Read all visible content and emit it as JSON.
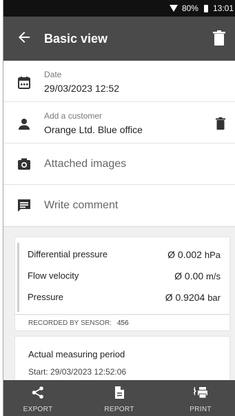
{
  "status_bar": {
    "battery": "80%",
    "time": "13:01"
  },
  "app_bar": {
    "title": "Basic view",
    "back_icon": "arrow-left-icon",
    "delete_icon": "trash-icon"
  },
  "date_row": {
    "label": "Date",
    "value": "29/03/2023 12:52",
    "icon": "calendar-icon"
  },
  "customer_row": {
    "label": "Add a customer",
    "value": "Orange Ltd. Blue office",
    "icon": "person-icon",
    "delete_icon": "trash-icon"
  },
  "images_row": {
    "label": "Attached images",
    "icon": "camera-icon"
  },
  "comment_row": {
    "label": "Write comment",
    "icon": "comment-icon"
  },
  "measurements": [
    {
      "name": "Differential pressure",
      "value": "Ø 0.002",
      "unit": "hPa"
    },
    {
      "name": "Flow velocity",
      "value": "Ø 0.00",
      "unit": "m/s"
    },
    {
      "name": "Pressure",
      "value": "Ø 0.9204",
      "unit": "bar"
    }
  ],
  "sensor": {
    "label": "RECORDED BY SENSOR:",
    "id": "456"
  },
  "period": {
    "title": "Actual measuring period",
    "start": "Start: 29/03/2023 12:52:06"
  },
  "bottom_bar": {
    "export": "EXPORT",
    "report": "REPORT",
    "print": "PRINT"
  },
  "colors": {
    "app_bar": "#4a4a4a",
    "status_bar": "#111111",
    "panel_bg": "#f0f0f0"
  }
}
